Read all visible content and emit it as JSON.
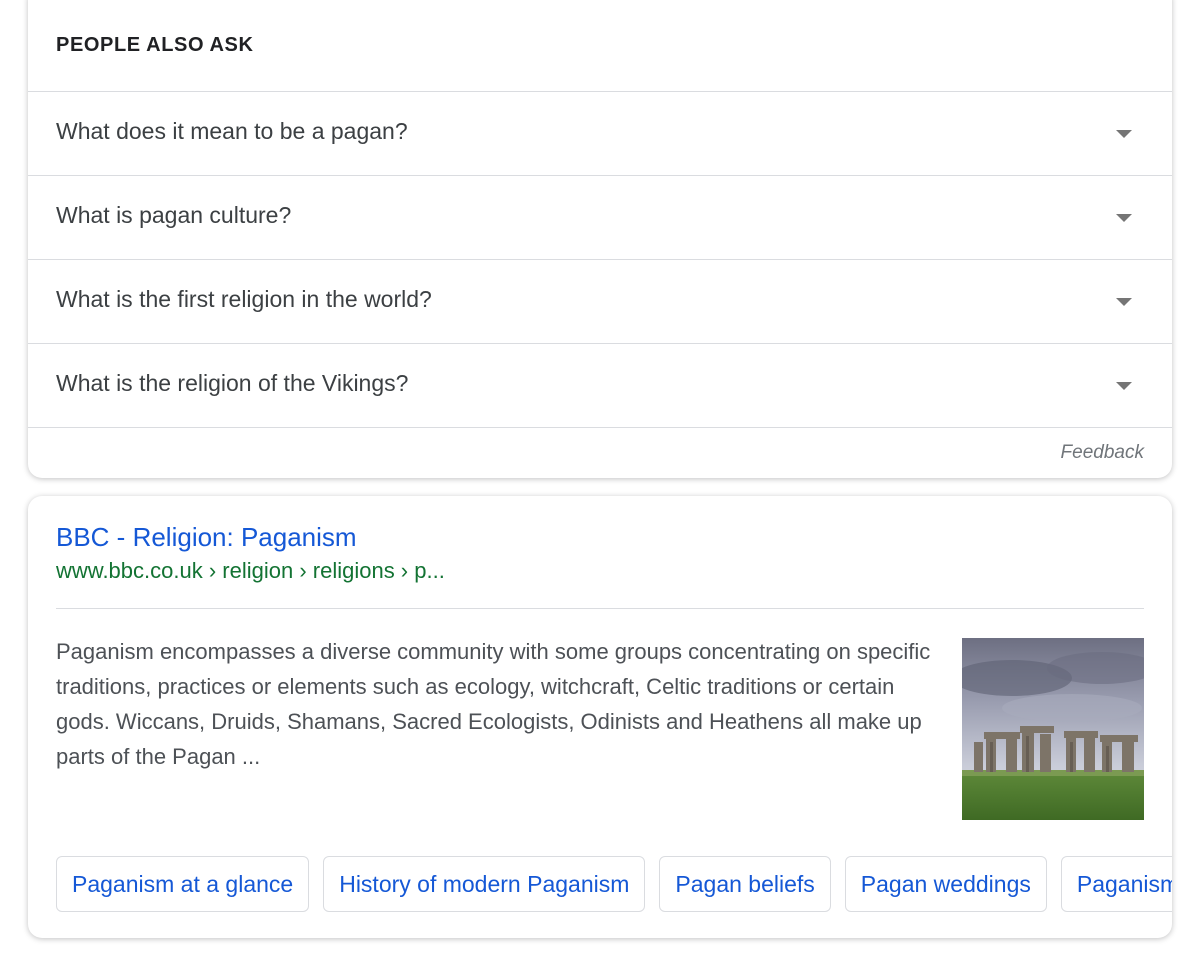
{
  "people_also_ask": {
    "header": "PEOPLE ALSO ASK",
    "questions": [
      "What does it mean to be a pagan?",
      "What is pagan culture?",
      "What is the first religion in the world?",
      "What is the religion of the Vikings?"
    ],
    "feedback_label": "Feedback"
  },
  "result": {
    "title": "BBC - Religion: Paganism",
    "url": "www.bbc.co.uk › religion › religions › p...",
    "snippet": "Paganism encompasses a diverse community with some groups concentrating on specific traditions, practices or elements such as ecology, witchcraft, Celtic traditions or certain gods. Wiccans, Druids, Shamans, Sacred Ecologists, Odinists and Heathens all make up parts of the Pagan ...",
    "thumbnail_icon": "stonehenge-image",
    "chips": [
      "Paganism at a glance",
      "History of modern Paganism",
      "Pagan beliefs",
      "Pagan weddings",
      "Paganism"
    ]
  },
  "colors": {
    "link": "#1558d6",
    "url": "#137333",
    "text": "#4d5156",
    "border": "#dadce0"
  }
}
